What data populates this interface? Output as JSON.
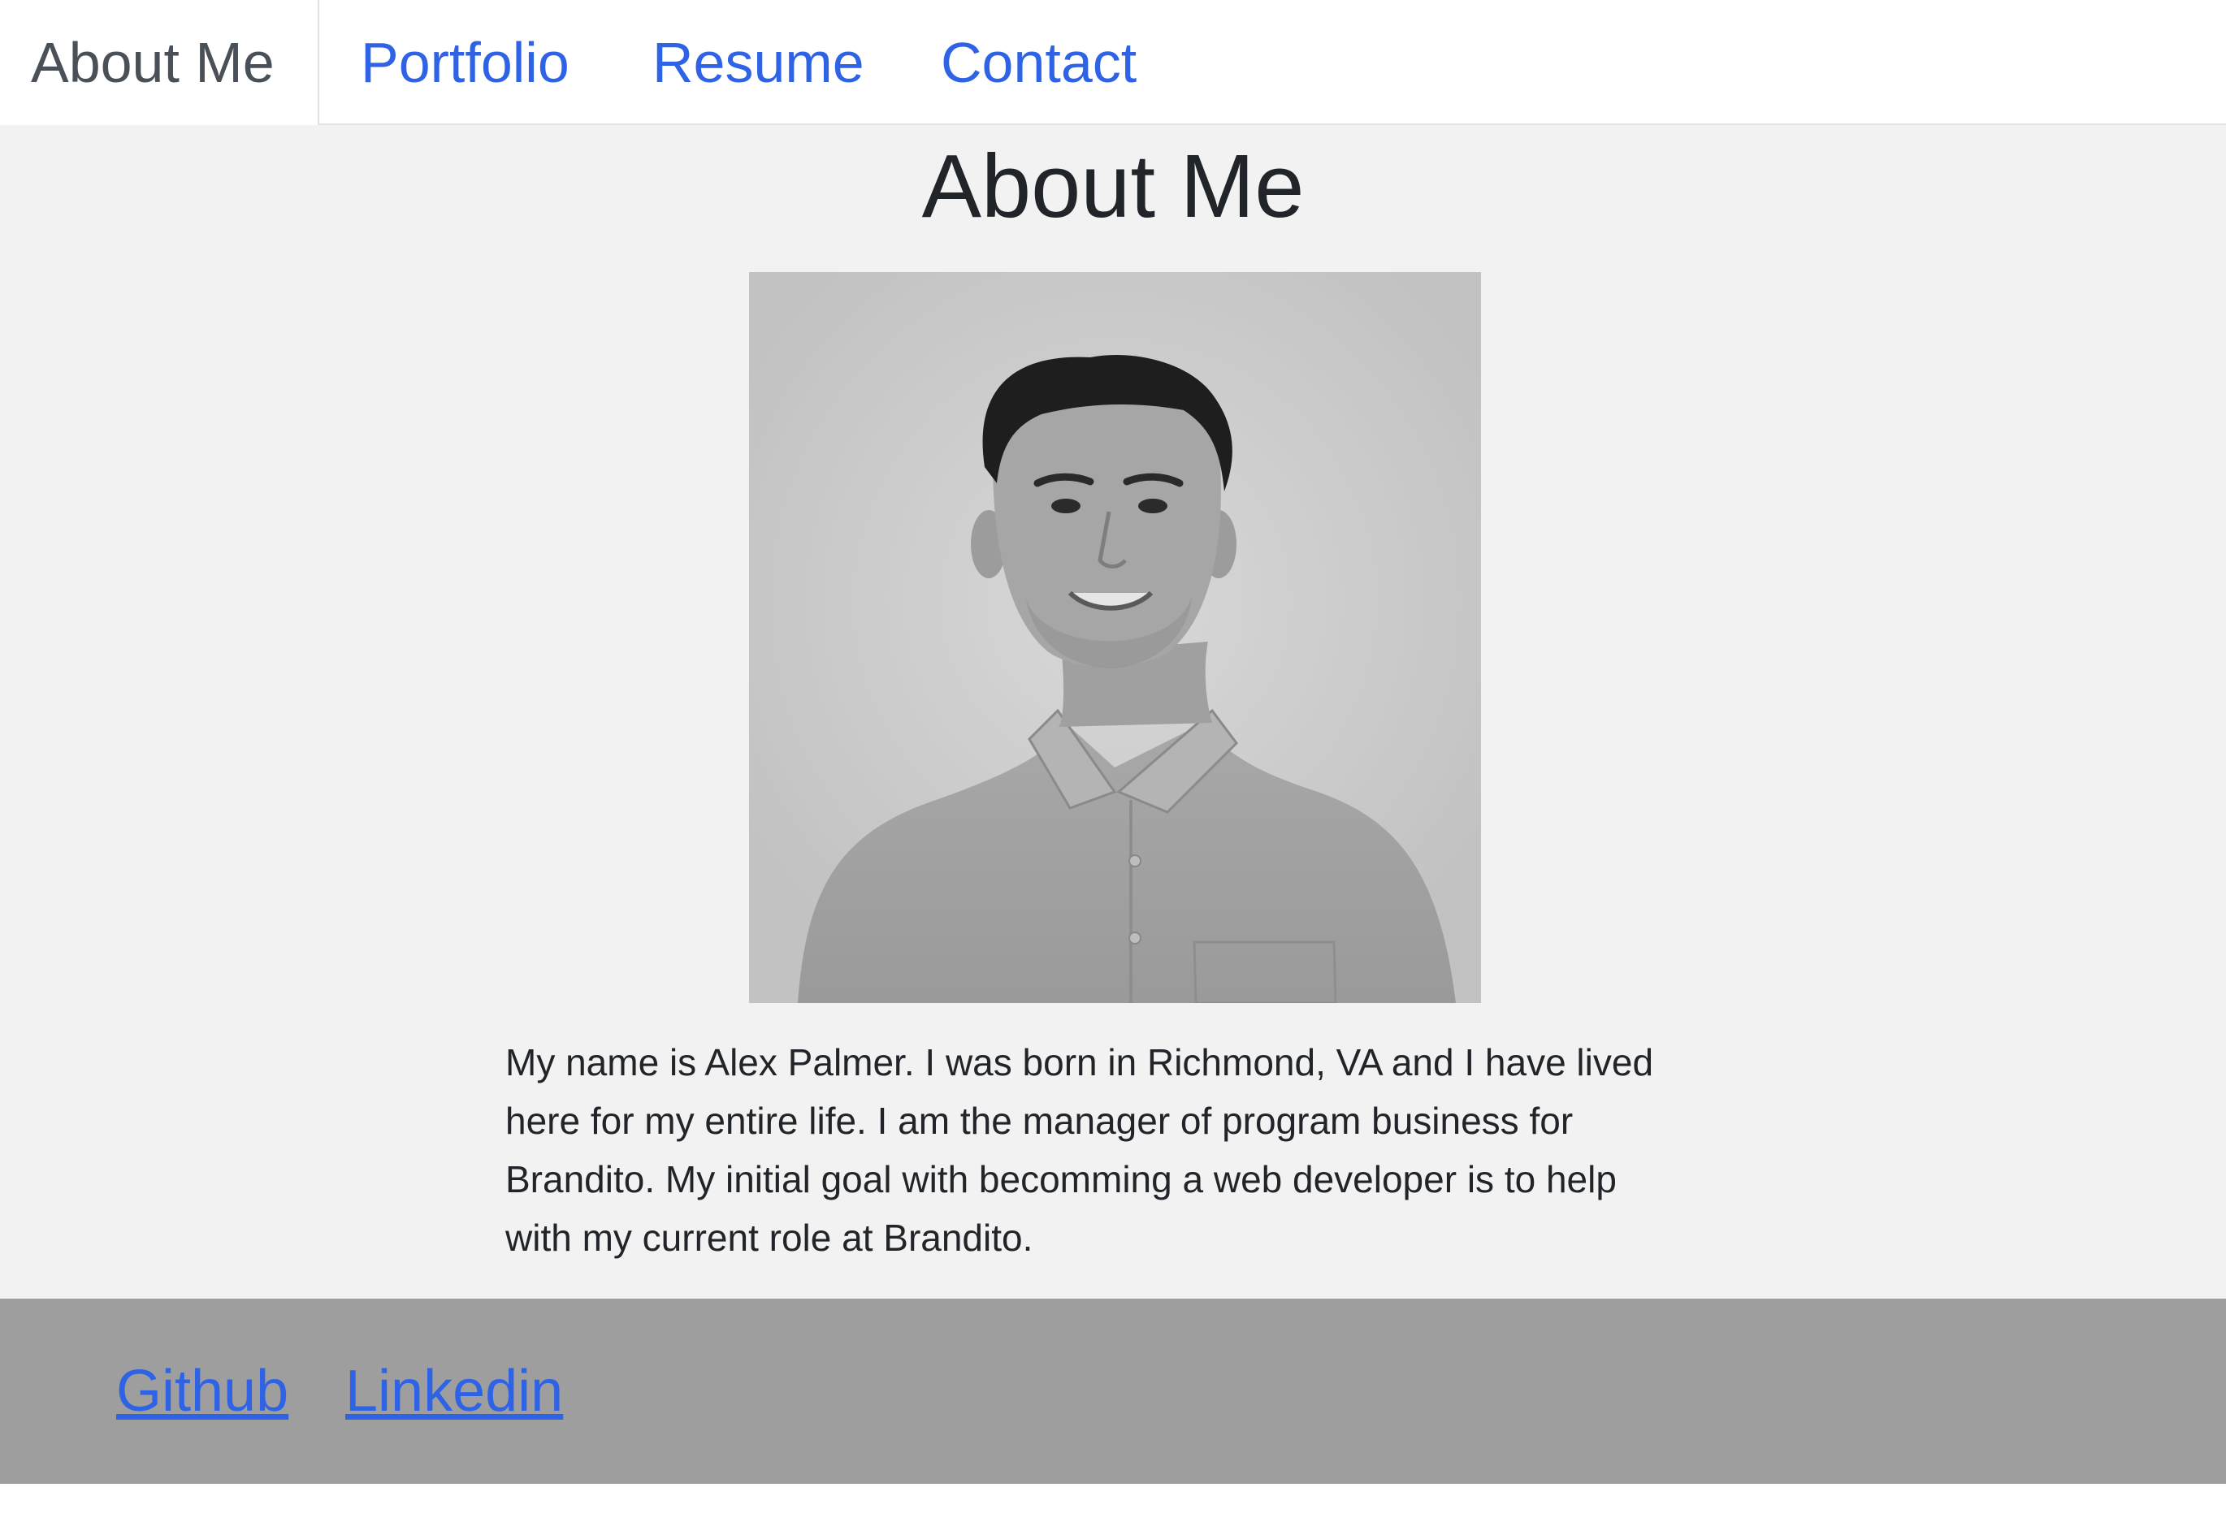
{
  "nav": {
    "tabs": [
      {
        "label": "About Me",
        "active": true
      },
      {
        "label": "Portfolio",
        "active": false
      },
      {
        "label": "Resume",
        "active": false
      },
      {
        "label": "Contact",
        "active": false
      }
    ]
  },
  "main": {
    "title": "About Me",
    "photo_icon": "profile-photo",
    "bio": "My name is Alex Palmer. I was born in Richmond, VA and I have lived here for my entire life. I am the manager of program business for Brandito. My initial goal with becomming a web developer is to help with my current role at Brandito."
  },
  "footer": {
    "links": [
      {
        "label": "Github"
      },
      {
        "label": "Linkedin"
      }
    ]
  },
  "colors": {
    "link": "#2f63e6",
    "active_tab_text": "#495057",
    "main_background": "#f2f2f2",
    "footer_background": "#9e9e9e",
    "photo_background": "#c4c4c4"
  }
}
